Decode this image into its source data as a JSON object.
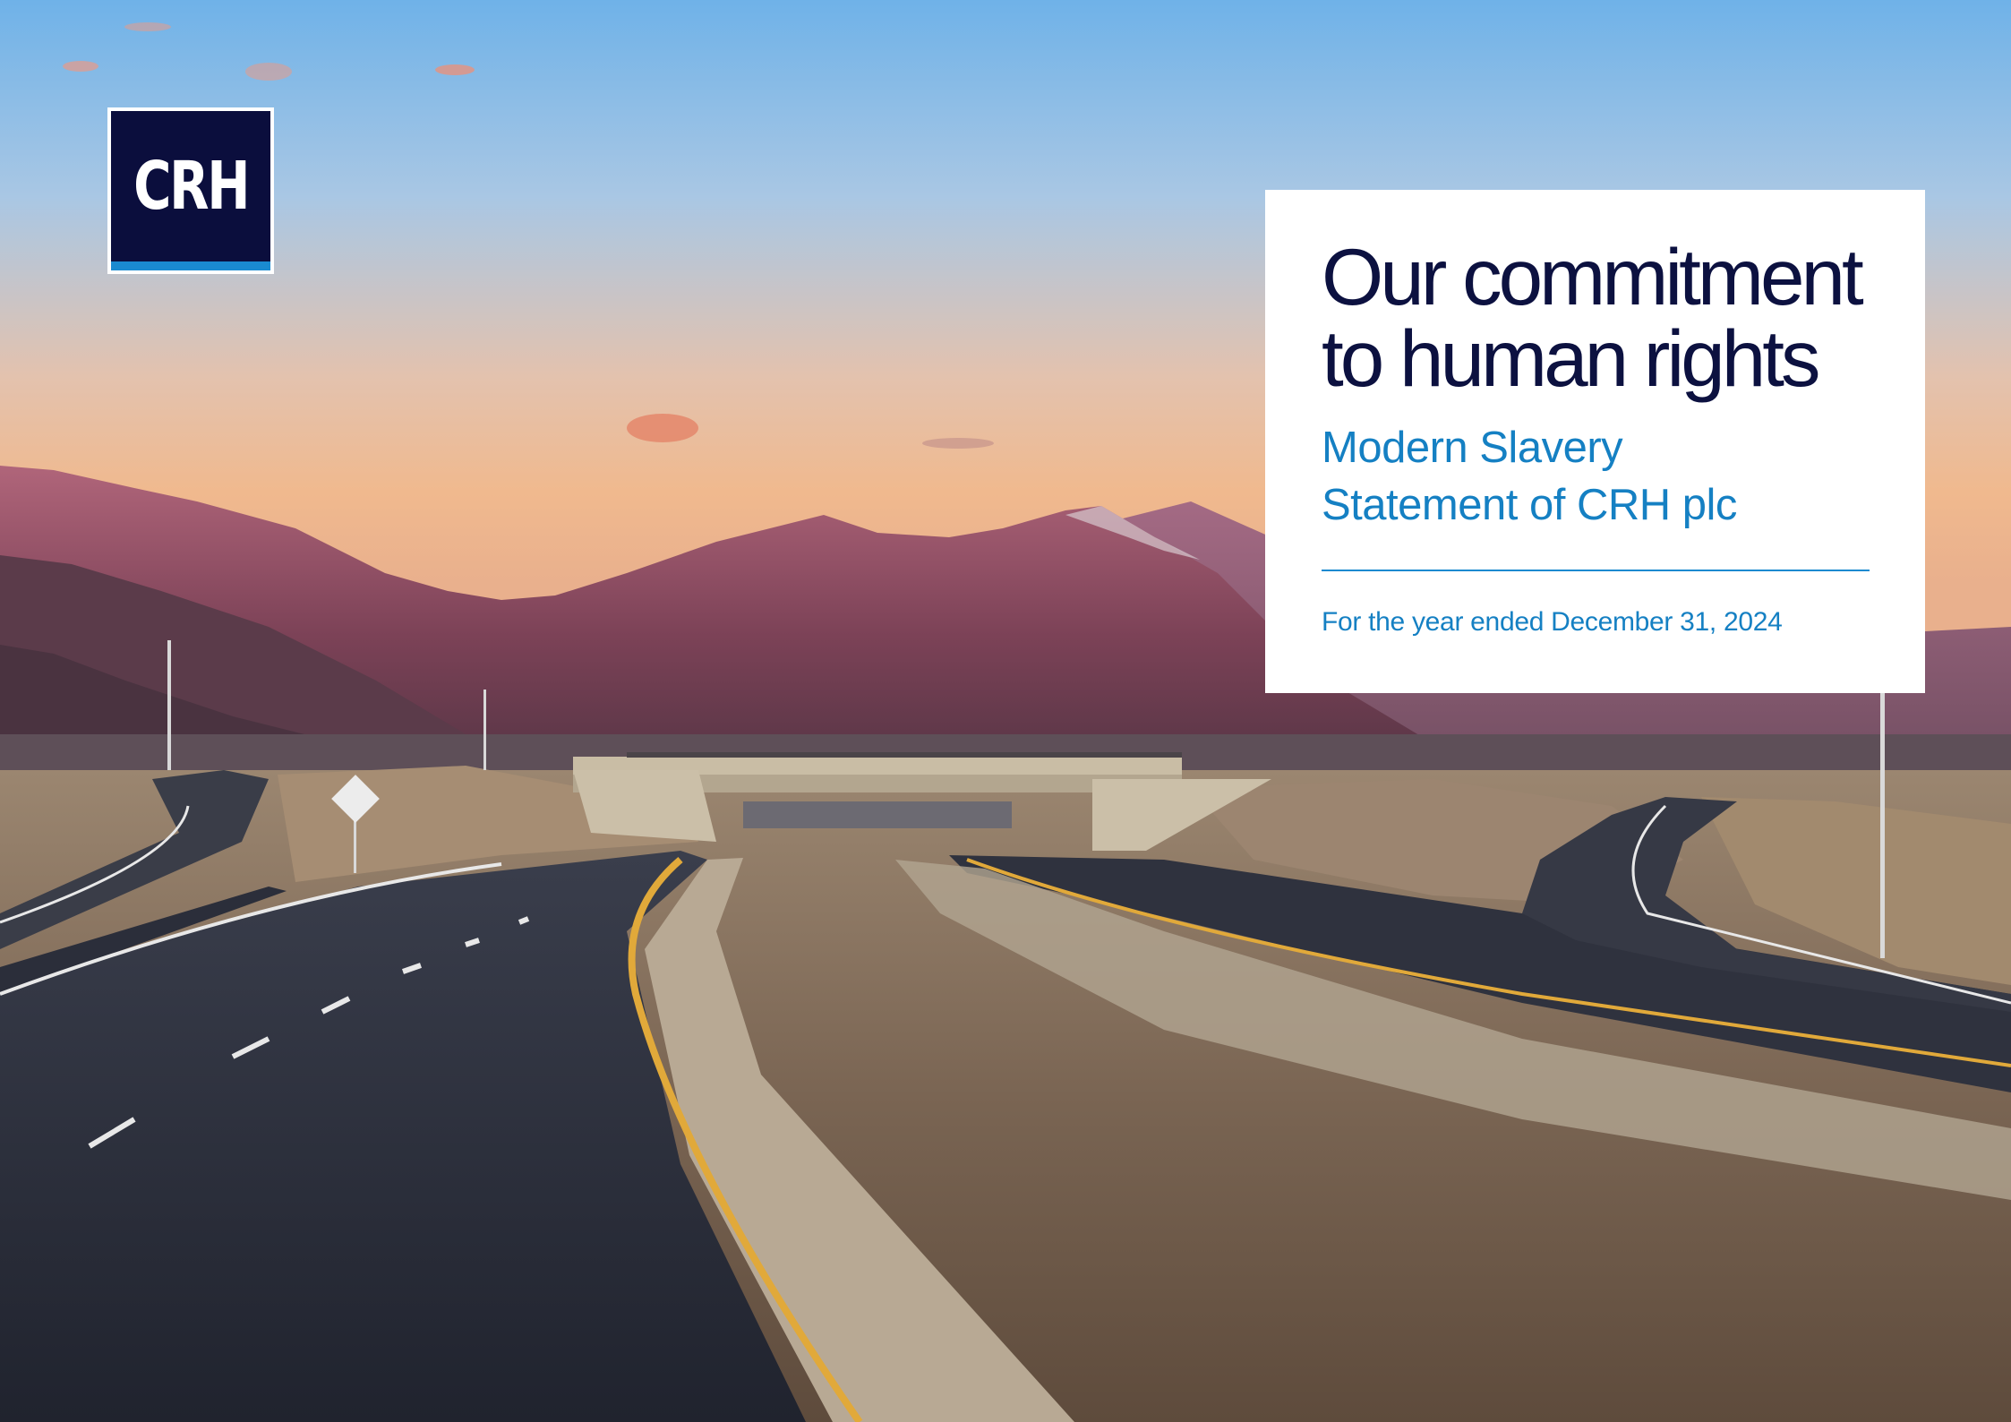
{
  "logo": {
    "text": "CRH"
  },
  "cover": {
    "title_line1": "Our commitment",
    "title_line2": "to human rights",
    "subtitle_line1": "Modern Slavery",
    "subtitle_line2": "Statement of CRH plc",
    "period": "For the year ended December 31, 2024"
  },
  "colors": {
    "navy": "#0b0e3d",
    "accent_blue": "#1580c3",
    "card_background": "#ffffff"
  }
}
